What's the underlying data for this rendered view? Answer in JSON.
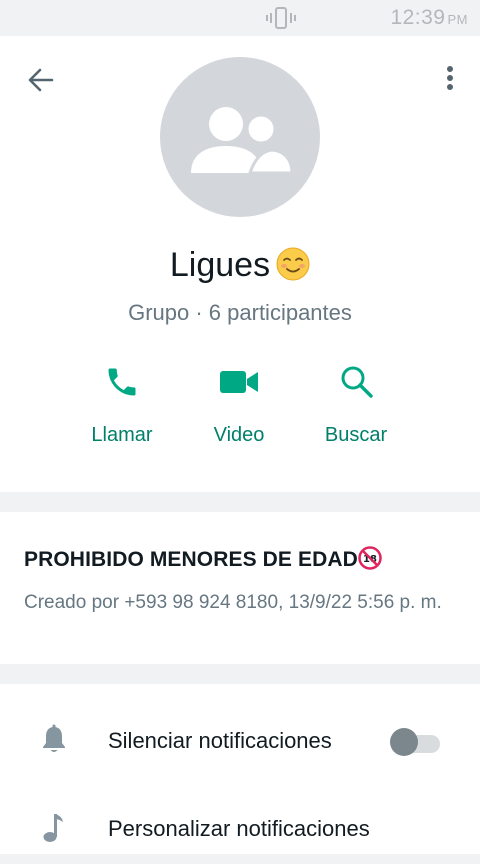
{
  "status_bar": {
    "time": "12:39",
    "ampm": "PM",
    "vibrate_icon": "vibrate-icon"
  },
  "header": {
    "back_icon": "arrow-left-icon",
    "menu_icon": "more-vert-icon",
    "avatar_icon": "group-avatar-icon",
    "group_name": "Ligues",
    "group_name_emoji": "smiling-face-icon",
    "group_meta": "Grupo · 6 participantes"
  },
  "actions": {
    "call_label": "Llamar",
    "video_label": "Video",
    "search_label": "Buscar",
    "accent_color": "#00a884"
  },
  "description": {
    "title": "PROHIBIDO MENORES DE EDAD",
    "title_icon": "no-one-under-eighteen-icon",
    "created": "Creado por +593 98 924 8180, 13/9/22 5:56 p. m."
  },
  "settings": {
    "mute_label": "Silenciar notificaciones",
    "mute_icon": "bell-icon",
    "mute_enabled": false,
    "custom_label": "Personalizar notificaciones",
    "custom_icon": "music-note-icon"
  }
}
